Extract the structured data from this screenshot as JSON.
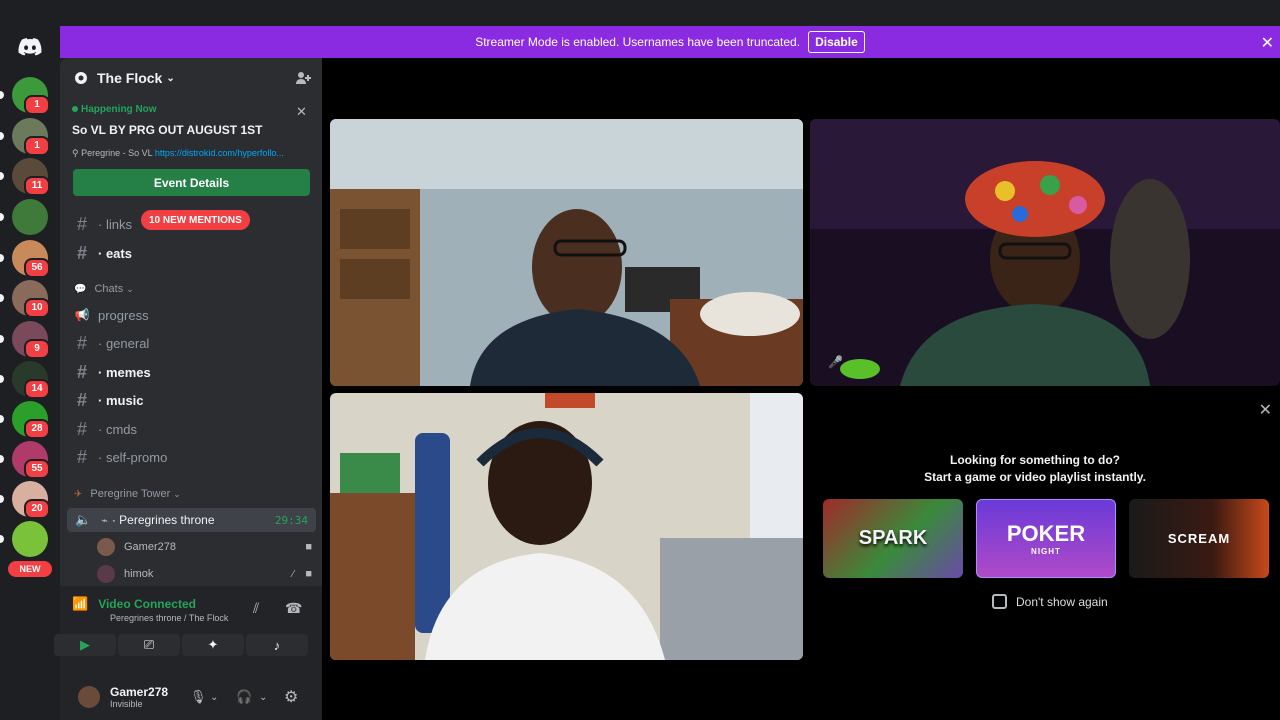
{
  "banner": {
    "message": "Streamer Mode is enabled. Usernames have been truncated.",
    "button": "Disable"
  },
  "servers": [
    {
      "badge": "1",
      "color": "#3c9a3c"
    },
    {
      "badge": "1",
      "color": "#6a7a5a"
    },
    {
      "badge": "11",
      "color": "#5a4a3a"
    },
    {
      "badge": "",
      "color": "#3f7a3a"
    },
    {
      "badge": "56",
      "color": "#c88a5a"
    },
    {
      "badge": "10",
      "color": "#8a6a5a"
    },
    {
      "badge": "9",
      "color": "#7a4a5a"
    },
    {
      "badge": "14",
      "color": "#2a3a2a"
    },
    {
      "badge": "28",
      "color": "#2aa02a"
    },
    {
      "badge": "55",
      "color": "#b03a6a"
    },
    {
      "badge": "20",
      "color": "#d8b0a0"
    },
    {
      "badge": "",
      "color": "#7ac23a"
    }
  ],
  "new_label": "NEW",
  "guild": {
    "name": "The Flock"
  },
  "event": {
    "status": "Happening Now",
    "title": "So VL BY PRG OUT AUGUST 1ST",
    "location_prefix": "Peregrine - So VL",
    "location_link": "https://distrokid.com/hyperfollo...",
    "button": "Event Details"
  },
  "mentions_pill": "10 NEW MENTIONS",
  "channels": [
    {
      "name": "· links",
      "bold": false
    },
    {
      "name": "· eats",
      "bold": true
    },
    {
      "name": "progress",
      "bold": false
    },
    {
      "name": "· general",
      "bold": false
    },
    {
      "name": "· memes",
      "bold": true
    },
    {
      "name": "· music",
      "bold": true
    },
    {
      "name": "· cmds",
      "bold": false
    },
    {
      "name": "· self-promo",
      "bold": false
    }
  ],
  "categories": {
    "chats": "Chats",
    "tower": "Peregrine Tower"
  },
  "voice_channel": {
    "name": "· Peregrines throne",
    "timer": "29:34"
  },
  "voice_users": [
    "Gamer278",
    "himok"
  ],
  "voice_panel": {
    "status": "Video Connected",
    "location": "Peregrines throne / The Flock"
  },
  "user": {
    "name": "Gamer278",
    "status": "Invisible"
  },
  "activity": {
    "line1": "Looking for something to do?",
    "line2": "Start a game or video playlist instantly.",
    "games": [
      "SPARK",
      "POKER",
      "SCREAM"
    ],
    "poker_sub": "NIGHT",
    "checkbox": "Don't show again"
  }
}
